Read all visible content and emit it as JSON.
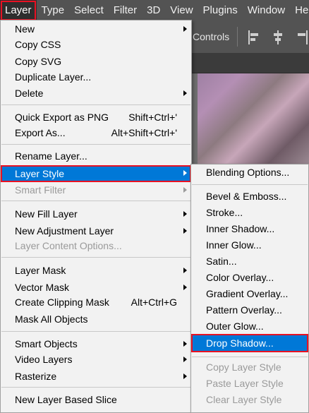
{
  "menubar": {
    "items": [
      {
        "label": "Layer",
        "active": true
      },
      {
        "label": "Type"
      },
      {
        "label": "Select"
      },
      {
        "label": "Filter"
      },
      {
        "label": "3D"
      },
      {
        "label": "View"
      },
      {
        "label": "Plugins"
      },
      {
        "label": "Window"
      },
      {
        "label": "Help"
      }
    ]
  },
  "options_bar": {
    "controls_label": "Controls",
    "icons": [
      "align-left-icon",
      "align-center-icon",
      "align-right-icon"
    ]
  },
  "layer_menu": {
    "new": "New",
    "copy_css": "Copy CSS",
    "copy_svg": "Copy SVG",
    "duplicate_layer": "Duplicate Layer...",
    "delete": "Delete",
    "quick_export": "Quick Export as PNG",
    "quick_export_shortcut": "Shift+Ctrl+'",
    "export_as": "Export As...",
    "export_as_shortcut": "Alt+Shift+Ctrl+'",
    "rename_layer": "Rename Layer...",
    "layer_style": "Layer Style",
    "smart_filter": "Smart Filter",
    "new_fill_layer": "New Fill Layer",
    "new_adjustment_layer": "New Adjustment Layer",
    "layer_content_options": "Layer Content Options...",
    "layer_mask": "Layer Mask",
    "vector_mask": "Vector Mask",
    "create_clipping_mask": "Create Clipping Mask",
    "create_clipping_mask_shortcut": "Alt+Ctrl+G",
    "mask_all_objects": "Mask All Objects",
    "smart_objects": "Smart Objects",
    "video_layers": "Video Layers",
    "rasterize": "Rasterize",
    "new_layer_based_slice": "New Layer Based Slice"
  },
  "layer_style_submenu": {
    "blending_options": "Blending Options...",
    "bevel_emboss": "Bevel & Emboss...",
    "stroke": "Stroke...",
    "inner_shadow": "Inner Shadow...",
    "inner_glow": "Inner Glow...",
    "satin": "Satin...",
    "color_overlay": "Color Overlay...",
    "gradient_overlay": "Gradient Overlay...",
    "pattern_overlay": "Pattern Overlay...",
    "outer_glow": "Outer Glow...",
    "drop_shadow": "Drop Shadow...",
    "copy_layer_style": "Copy Layer Style",
    "paste_layer_style": "Paste Layer Style",
    "clear_layer_style": "Clear Layer Style"
  },
  "colors": {
    "highlight": "#0078d7",
    "selection_outline": "#e81123",
    "menu_bg": "#f2f2f2",
    "app_bg": "#535353"
  }
}
